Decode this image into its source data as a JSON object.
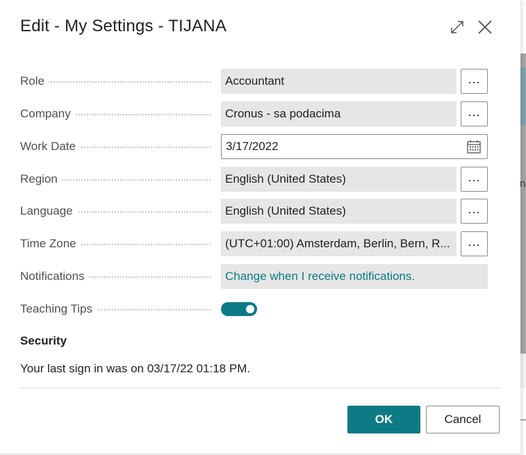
{
  "dialog": {
    "title": "Edit - My Settings - TIJANA",
    "expand_icon": "expand-icon",
    "close_icon": "close-icon"
  },
  "fields": {
    "role": {
      "label": "Role",
      "value": "Accountant",
      "action_label": "..."
    },
    "company": {
      "label": "Company",
      "value": "Cronus - sa podacima",
      "action_label": "..."
    },
    "work_date": {
      "label": "Work Date",
      "value": "3/17/2022",
      "icon": "calendar-icon"
    },
    "region": {
      "label": "Region",
      "value": "English (United States)",
      "action_label": "..."
    },
    "language": {
      "label": "Language",
      "value": "English (United States)",
      "action_label": "..."
    },
    "time_zone": {
      "label": "Time Zone",
      "value": "(UTC+01:00) Amsterdam, Berlin, Bern, R...",
      "action_label": "..."
    },
    "notifications": {
      "label": "Notifications",
      "value": "Change when I receive notifications."
    },
    "teaching_tips": {
      "label": "Teaching Tips",
      "enabled": true
    }
  },
  "security": {
    "heading": "Security",
    "last_sign_in": "Your last sign in was on 03/17/22 01:18 PM."
  },
  "buttons": {
    "ok": "OK",
    "cancel": "Cancel"
  },
  "background": {
    "partial_letter": "n"
  },
  "colors": {
    "accent": "#0c7b85",
    "field_bg": "#e6e6e6"
  }
}
